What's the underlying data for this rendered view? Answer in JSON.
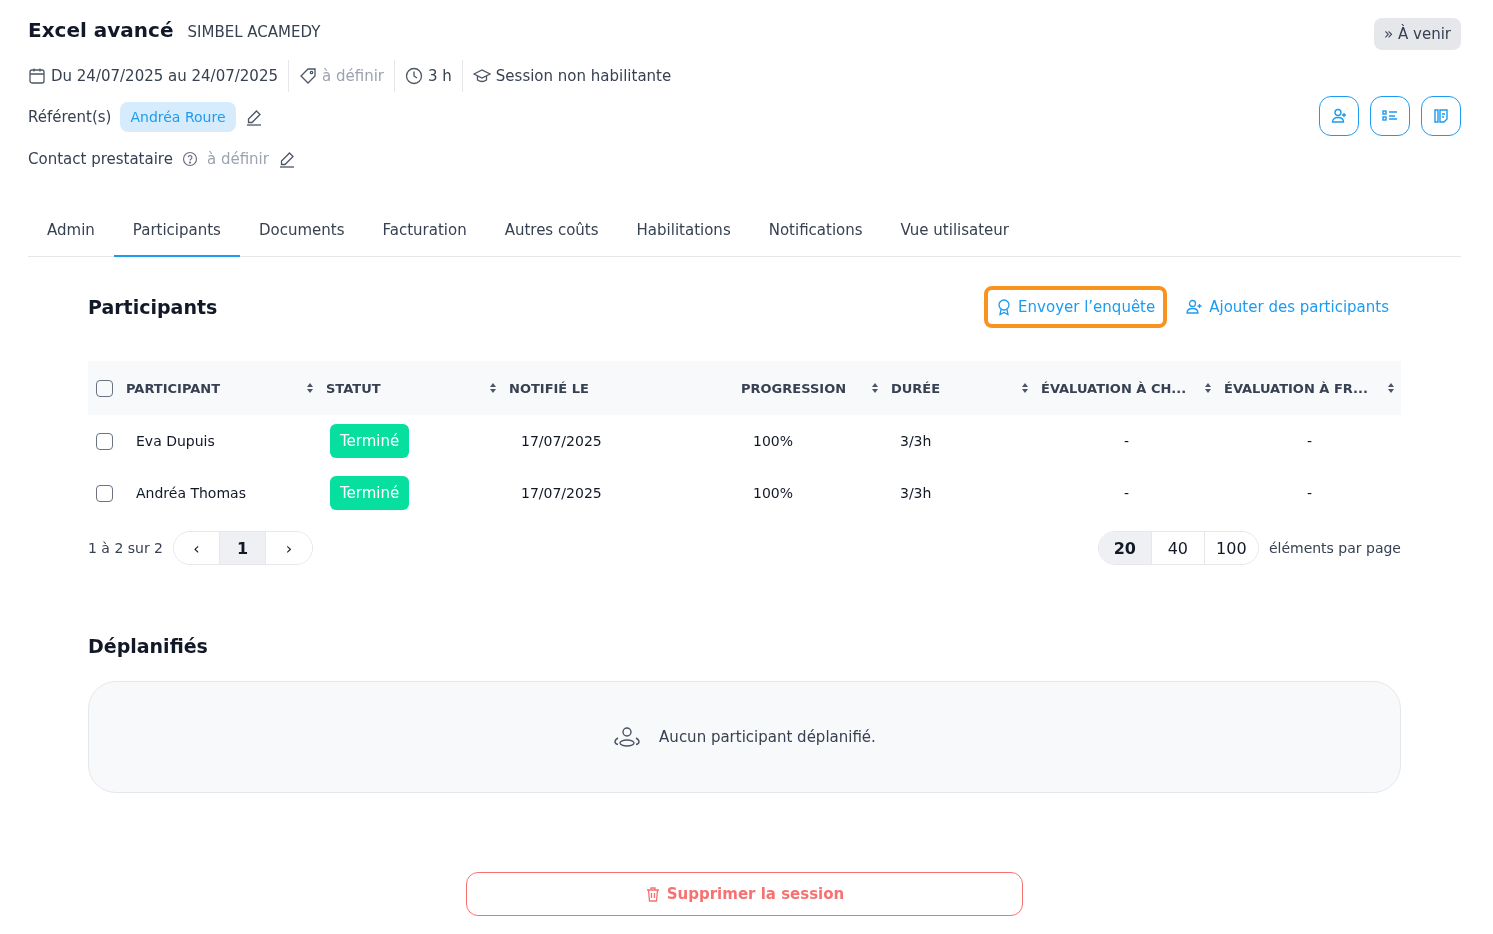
{
  "header": {
    "title": "Excel avancé",
    "organization": "SIMBEL ACAMEDY",
    "status": "À venir",
    "status_icon": "»",
    "meta": [
      {
        "kind": "date",
        "text": "Du 24/07/2025 au 24/07/2025",
        "muted": false
      },
      {
        "kind": "tag",
        "text": "à définir",
        "muted": true
      },
      {
        "kind": "clock",
        "text": "3 h",
        "muted": false
      },
      {
        "kind": "cap",
        "text": "Session non habilitante",
        "muted": false
      }
    ],
    "referents_label": "Référent(s)",
    "referents": [
      "Andréa Roure"
    ],
    "contact_label": "Contact prestataire",
    "contact_value": "à définir"
  },
  "tabs": [
    {
      "label": "Admin",
      "selected": false
    },
    {
      "label": "Participants",
      "selected": true
    },
    {
      "label": "Documents",
      "selected": false
    },
    {
      "label": "Facturation",
      "selected": false
    },
    {
      "label": "Autres coûts",
      "selected": false
    },
    {
      "label": "Habilitations",
      "selected": false
    },
    {
      "label": "Notifications",
      "selected": false
    },
    {
      "label": "Vue utilisateur",
      "selected": false
    }
  ],
  "participants": {
    "title": "Participants",
    "actions": [
      {
        "kind": "survey",
        "label": "Envoyer l’enquête",
        "highlighted": true
      },
      {
        "kind": "add",
        "label": "Ajouter des participants",
        "highlighted": false
      }
    ],
    "table": {
      "select_all": false,
      "columns": [
        {
          "label": "PARTICIPANT",
          "sortable": true
        },
        {
          "label": "STATUT",
          "sortable": true
        },
        {
          "label": "NOTIFIÉ LE",
          "sortable": false
        },
        {
          "label": "PROGRESSION",
          "sortable": true
        },
        {
          "label": "DURÉE",
          "sortable": true
        },
        {
          "label": "ÉVALUATION À CH...",
          "sortable": true
        },
        {
          "label": "ÉVALUATION À FR...",
          "sortable": true
        }
      ],
      "rows": [
        {
          "checked": false,
          "cells": [
            "Eva Dupuis",
            "Terminé",
            "17/07/2025",
            "100%",
            "3/3h",
            "-",
            "-"
          ]
        },
        {
          "checked": false,
          "cells": [
            "Andréa Thomas",
            "Terminé",
            "17/07/2025",
            "100%",
            "3/3h",
            "-",
            "-"
          ]
        }
      ]
    },
    "range": "1 à 2 sur 2",
    "prev": "‹",
    "page": "1",
    "next": "›",
    "page_sizes": [
      {
        "label": "20",
        "selected": true
      },
      {
        "label": "40",
        "selected": false
      },
      {
        "label": "100",
        "selected": false
      }
    ],
    "page_size_label": "éléments par page"
  },
  "unplanned": {
    "title": "Déplanifiés",
    "empty": "Aucun participant déplanifié."
  },
  "delete_button": "Supprimer la session"
}
